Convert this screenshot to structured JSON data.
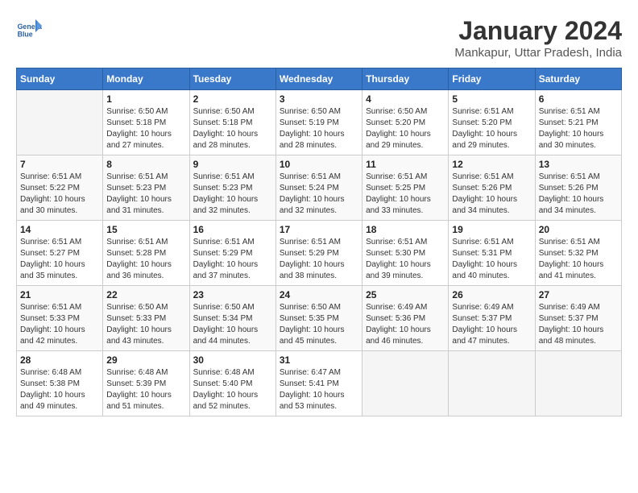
{
  "header": {
    "logo_line1": "General",
    "logo_line2": "Blue",
    "month_year": "January 2024",
    "location": "Mankapur, Uttar Pradesh, India"
  },
  "weekdays": [
    "Sunday",
    "Monday",
    "Tuesday",
    "Wednesday",
    "Thursday",
    "Friday",
    "Saturday"
  ],
  "weeks": [
    [
      {
        "day": "",
        "sunrise": "",
        "sunset": "",
        "daylight": "",
        "empty": true
      },
      {
        "day": "1",
        "sunrise": "Sunrise: 6:50 AM",
        "sunset": "Sunset: 5:18 PM",
        "daylight": "Daylight: 10 hours and 27 minutes."
      },
      {
        "day": "2",
        "sunrise": "Sunrise: 6:50 AM",
        "sunset": "Sunset: 5:18 PM",
        "daylight": "Daylight: 10 hours and 28 minutes."
      },
      {
        "day": "3",
        "sunrise": "Sunrise: 6:50 AM",
        "sunset": "Sunset: 5:19 PM",
        "daylight": "Daylight: 10 hours and 28 minutes."
      },
      {
        "day": "4",
        "sunrise": "Sunrise: 6:50 AM",
        "sunset": "Sunset: 5:20 PM",
        "daylight": "Daylight: 10 hours and 29 minutes."
      },
      {
        "day": "5",
        "sunrise": "Sunrise: 6:51 AM",
        "sunset": "Sunset: 5:20 PM",
        "daylight": "Daylight: 10 hours and 29 minutes."
      },
      {
        "day": "6",
        "sunrise": "Sunrise: 6:51 AM",
        "sunset": "Sunset: 5:21 PM",
        "daylight": "Daylight: 10 hours and 30 minutes."
      }
    ],
    [
      {
        "day": "7",
        "sunrise": "Sunrise: 6:51 AM",
        "sunset": "Sunset: 5:22 PM",
        "daylight": "Daylight: 10 hours and 30 minutes."
      },
      {
        "day": "8",
        "sunrise": "Sunrise: 6:51 AM",
        "sunset": "Sunset: 5:23 PM",
        "daylight": "Daylight: 10 hours and 31 minutes."
      },
      {
        "day": "9",
        "sunrise": "Sunrise: 6:51 AM",
        "sunset": "Sunset: 5:23 PM",
        "daylight": "Daylight: 10 hours and 32 minutes."
      },
      {
        "day": "10",
        "sunrise": "Sunrise: 6:51 AM",
        "sunset": "Sunset: 5:24 PM",
        "daylight": "Daylight: 10 hours and 32 minutes."
      },
      {
        "day": "11",
        "sunrise": "Sunrise: 6:51 AM",
        "sunset": "Sunset: 5:25 PM",
        "daylight": "Daylight: 10 hours and 33 minutes."
      },
      {
        "day": "12",
        "sunrise": "Sunrise: 6:51 AM",
        "sunset": "Sunset: 5:26 PM",
        "daylight": "Daylight: 10 hours and 34 minutes."
      },
      {
        "day": "13",
        "sunrise": "Sunrise: 6:51 AM",
        "sunset": "Sunset: 5:26 PM",
        "daylight": "Daylight: 10 hours and 34 minutes."
      }
    ],
    [
      {
        "day": "14",
        "sunrise": "Sunrise: 6:51 AM",
        "sunset": "Sunset: 5:27 PM",
        "daylight": "Daylight: 10 hours and 35 minutes."
      },
      {
        "day": "15",
        "sunrise": "Sunrise: 6:51 AM",
        "sunset": "Sunset: 5:28 PM",
        "daylight": "Daylight: 10 hours and 36 minutes."
      },
      {
        "day": "16",
        "sunrise": "Sunrise: 6:51 AM",
        "sunset": "Sunset: 5:29 PM",
        "daylight": "Daylight: 10 hours and 37 minutes."
      },
      {
        "day": "17",
        "sunrise": "Sunrise: 6:51 AM",
        "sunset": "Sunset: 5:29 PM",
        "daylight": "Daylight: 10 hours and 38 minutes."
      },
      {
        "day": "18",
        "sunrise": "Sunrise: 6:51 AM",
        "sunset": "Sunset: 5:30 PM",
        "daylight": "Daylight: 10 hours and 39 minutes."
      },
      {
        "day": "19",
        "sunrise": "Sunrise: 6:51 AM",
        "sunset": "Sunset: 5:31 PM",
        "daylight": "Daylight: 10 hours and 40 minutes."
      },
      {
        "day": "20",
        "sunrise": "Sunrise: 6:51 AM",
        "sunset": "Sunset: 5:32 PM",
        "daylight": "Daylight: 10 hours and 41 minutes."
      }
    ],
    [
      {
        "day": "21",
        "sunrise": "Sunrise: 6:51 AM",
        "sunset": "Sunset: 5:33 PM",
        "daylight": "Daylight: 10 hours and 42 minutes."
      },
      {
        "day": "22",
        "sunrise": "Sunrise: 6:50 AM",
        "sunset": "Sunset: 5:33 PM",
        "daylight": "Daylight: 10 hours and 43 minutes."
      },
      {
        "day": "23",
        "sunrise": "Sunrise: 6:50 AM",
        "sunset": "Sunset: 5:34 PM",
        "daylight": "Daylight: 10 hours and 44 minutes."
      },
      {
        "day": "24",
        "sunrise": "Sunrise: 6:50 AM",
        "sunset": "Sunset: 5:35 PM",
        "daylight": "Daylight: 10 hours and 45 minutes."
      },
      {
        "day": "25",
        "sunrise": "Sunrise: 6:49 AM",
        "sunset": "Sunset: 5:36 PM",
        "daylight": "Daylight: 10 hours and 46 minutes."
      },
      {
        "day": "26",
        "sunrise": "Sunrise: 6:49 AM",
        "sunset": "Sunset: 5:37 PM",
        "daylight": "Daylight: 10 hours and 47 minutes."
      },
      {
        "day": "27",
        "sunrise": "Sunrise: 6:49 AM",
        "sunset": "Sunset: 5:37 PM",
        "daylight": "Daylight: 10 hours and 48 minutes."
      }
    ],
    [
      {
        "day": "28",
        "sunrise": "Sunrise: 6:48 AM",
        "sunset": "Sunset: 5:38 PM",
        "daylight": "Daylight: 10 hours and 49 minutes."
      },
      {
        "day": "29",
        "sunrise": "Sunrise: 6:48 AM",
        "sunset": "Sunset: 5:39 PM",
        "daylight": "Daylight: 10 hours and 51 minutes."
      },
      {
        "day": "30",
        "sunrise": "Sunrise: 6:48 AM",
        "sunset": "Sunset: 5:40 PM",
        "daylight": "Daylight: 10 hours and 52 minutes."
      },
      {
        "day": "31",
        "sunrise": "Sunrise: 6:47 AM",
        "sunset": "Sunset: 5:41 PM",
        "daylight": "Daylight: 10 hours and 53 minutes."
      },
      {
        "day": "",
        "sunrise": "",
        "sunset": "",
        "daylight": "",
        "empty": true
      },
      {
        "day": "",
        "sunrise": "",
        "sunset": "",
        "daylight": "",
        "empty": true
      },
      {
        "day": "",
        "sunrise": "",
        "sunset": "",
        "daylight": "",
        "empty": true
      }
    ]
  ]
}
